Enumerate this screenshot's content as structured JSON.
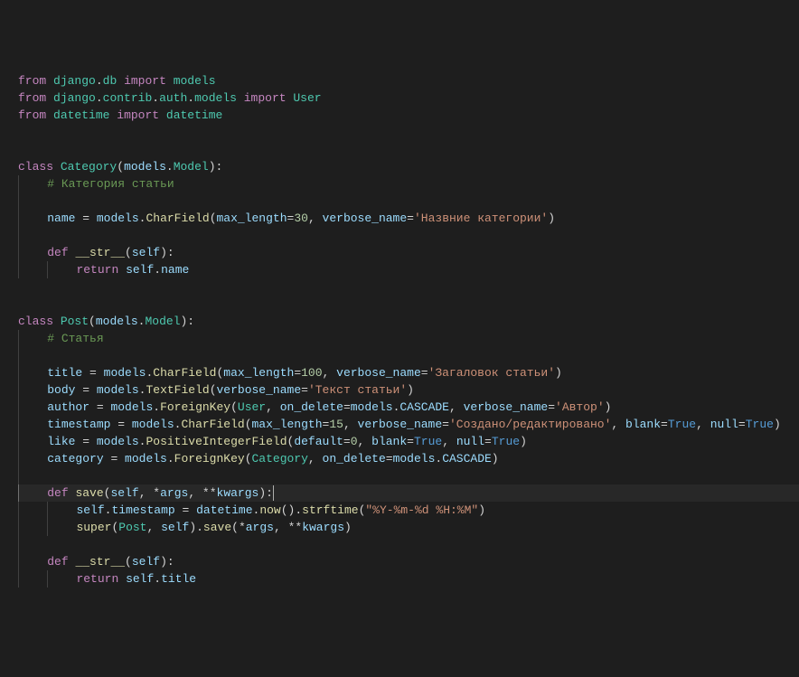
{
  "language": "python",
  "filename": "models.py",
  "cursor_line": 25,
  "lines": [
    {
      "indent": 0,
      "tokens": [
        {
          "c": "kw",
          "t": "from"
        },
        {
          "c": "punct",
          "t": " "
        },
        {
          "c": "mod",
          "t": "django"
        },
        {
          "c": "punct",
          "t": "."
        },
        {
          "c": "mod",
          "t": "db"
        },
        {
          "c": "punct",
          "t": " "
        },
        {
          "c": "kw",
          "t": "import"
        },
        {
          "c": "punct",
          "t": " "
        },
        {
          "c": "mod",
          "t": "models"
        }
      ]
    },
    {
      "indent": 0,
      "tokens": [
        {
          "c": "kw",
          "t": "from"
        },
        {
          "c": "punct",
          "t": " "
        },
        {
          "c": "mod",
          "t": "django"
        },
        {
          "c": "punct",
          "t": "."
        },
        {
          "c": "mod",
          "t": "contrib"
        },
        {
          "c": "punct",
          "t": "."
        },
        {
          "c": "mod",
          "t": "auth"
        },
        {
          "c": "punct",
          "t": "."
        },
        {
          "c": "mod",
          "t": "models"
        },
        {
          "c": "punct",
          "t": " "
        },
        {
          "c": "kw",
          "t": "import"
        },
        {
          "c": "punct",
          "t": " "
        },
        {
          "c": "mod",
          "t": "User"
        }
      ]
    },
    {
      "indent": 0,
      "tokens": [
        {
          "c": "kw",
          "t": "from"
        },
        {
          "c": "punct",
          "t": " "
        },
        {
          "c": "mod",
          "t": "datetime"
        },
        {
          "c": "punct",
          "t": " "
        },
        {
          "c": "kw",
          "t": "import"
        },
        {
          "c": "punct",
          "t": " "
        },
        {
          "c": "mod",
          "t": "datetime"
        }
      ]
    },
    {
      "indent": 0,
      "tokens": []
    },
    {
      "indent": 0,
      "tokens": []
    },
    {
      "indent": 0,
      "tokens": [
        {
          "c": "kw",
          "t": "class"
        },
        {
          "c": "punct",
          "t": " "
        },
        {
          "c": "mod",
          "t": "Category"
        },
        {
          "c": "punct",
          "t": "("
        },
        {
          "c": "name",
          "t": "models"
        },
        {
          "c": "punct",
          "t": "."
        },
        {
          "c": "mod",
          "t": "Model"
        },
        {
          "c": "punct",
          "t": "):"
        }
      ]
    },
    {
      "indent": 1,
      "tokens": [
        {
          "c": "comment",
          "t": "# Категория статьи"
        }
      ]
    },
    {
      "indent": 1,
      "tokens": []
    },
    {
      "indent": 1,
      "tokens": [
        {
          "c": "name",
          "t": "name"
        },
        {
          "c": "punct",
          "t": " = "
        },
        {
          "c": "name",
          "t": "models"
        },
        {
          "c": "punct",
          "t": "."
        },
        {
          "c": "fn",
          "t": "CharField"
        },
        {
          "c": "punct",
          "t": "("
        },
        {
          "c": "param",
          "t": "max_length"
        },
        {
          "c": "punct",
          "t": "="
        },
        {
          "c": "num",
          "t": "30"
        },
        {
          "c": "punct",
          "t": ", "
        },
        {
          "c": "param",
          "t": "verbose_name"
        },
        {
          "c": "punct",
          "t": "="
        },
        {
          "c": "str",
          "t": "'Назвние категории'"
        },
        {
          "c": "punct",
          "t": ")"
        }
      ]
    },
    {
      "indent": 1,
      "tokens": []
    },
    {
      "indent": 1,
      "tokens": [
        {
          "c": "kw",
          "t": "def"
        },
        {
          "c": "punct",
          "t": " "
        },
        {
          "c": "fn",
          "t": "__str__"
        },
        {
          "c": "punct",
          "t": "("
        },
        {
          "c": "param",
          "t": "self"
        },
        {
          "c": "punct",
          "t": "):"
        }
      ]
    },
    {
      "indent": 2,
      "tokens": [
        {
          "c": "kw",
          "t": "return"
        },
        {
          "c": "punct",
          "t": " "
        },
        {
          "c": "name",
          "t": "self"
        },
        {
          "c": "punct",
          "t": "."
        },
        {
          "c": "name",
          "t": "name"
        }
      ]
    },
    {
      "indent": 0,
      "tokens": []
    },
    {
      "indent": 0,
      "tokens": []
    },
    {
      "indent": 0,
      "tokens": [
        {
          "c": "kw",
          "t": "class"
        },
        {
          "c": "punct",
          "t": " "
        },
        {
          "c": "mod",
          "t": "Post"
        },
        {
          "c": "punct",
          "t": "("
        },
        {
          "c": "name",
          "t": "models"
        },
        {
          "c": "punct",
          "t": "."
        },
        {
          "c": "mod",
          "t": "Model"
        },
        {
          "c": "punct",
          "t": "):"
        }
      ]
    },
    {
      "indent": 1,
      "tokens": [
        {
          "c": "comment",
          "t": "# Статья"
        }
      ]
    },
    {
      "indent": 1,
      "tokens": []
    },
    {
      "indent": 1,
      "tokens": [
        {
          "c": "name",
          "t": "title"
        },
        {
          "c": "punct",
          "t": " = "
        },
        {
          "c": "name",
          "t": "models"
        },
        {
          "c": "punct",
          "t": "."
        },
        {
          "c": "fn",
          "t": "CharField"
        },
        {
          "c": "punct",
          "t": "("
        },
        {
          "c": "param",
          "t": "max_length"
        },
        {
          "c": "punct",
          "t": "="
        },
        {
          "c": "num",
          "t": "100"
        },
        {
          "c": "punct",
          "t": ", "
        },
        {
          "c": "param",
          "t": "verbose_name"
        },
        {
          "c": "punct",
          "t": "="
        },
        {
          "c": "str",
          "t": "'Загаловок статьи'"
        },
        {
          "c": "punct",
          "t": ")"
        }
      ]
    },
    {
      "indent": 1,
      "tokens": [
        {
          "c": "name",
          "t": "body"
        },
        {
          "c": "punct",
          "t": " = "
        },
        {
          "c": "name",
          "t": "models"
        },
        {
          "c": "punct",
          "t": "."
        },
        {
          "c": "fn",
          "t": "TextField"
        },
        {
          "c": "punct",
          "t": "("
        },
        {
          "c": "param",
          "t": "verbose_name"
        },
        {
          "c": "punct",
          "t": "="
        },
        {
          "c": "str",
          "t": "'Текст статьи'"
        },
        {
          "c": "punct",
          "t": ")"
        }
      ]
    },
    {
      "indent": 1,
      "tokens": [
        {
          "c": "name",
          "t": "author"
        },
        {
          "c": "punct",
          "t": " = "
        },
        {
          "c": "name",
          "t": "models"
        },
        {
          "c": "punct",
          "t": "."
        },
        {
          "c": "fn",
          "t": "ForeignKey"
        },
        {
          "c": "punct",
          "t": "("
        },
        {
          "c": "mod",
          "t": "User"
        },
        {
          "c": "punct",
          "t": ", "
        },
        {
          "c": "param",
          "t": "on_delete"
        },
        {
          "c": "punct",
          "t": "="
        },
        {
          "c": "name",
          "t": "models"
        },
        {
          "c": "punct",
          "t": "."
        },
        {
          "c": "name",
          "t": "CASCADE"
        },
        {
          "c": "punct",
          "t": ", "
        },
        {
          "c": "param",
          "t": "verbose_name"
        },
        {
          "c": "punct",
          "t": "="
        },
        {
          "c": "str",
          "t": "'Автор'"
        },
        {
          "c": "punct",
          "t": ")"
        }
      ]
    },
    {
      "indent": 1,
      "tokens": [
        {
          "c": "name",
          "t": "timestamp"
        },
        {
          "c": "punct",
          "t": " = "
        },
        {
          "c": "name",
          "t": "models"
        },
        {
          "c": "punct",
          "t": "."
        },
        {
          "c": "fn",
          "t": "CharField"
        },
        {
          "c": "punct",
          "t": "("
        },
        {
          "c": "param",
          "t": "max_length"
        },
        {
          "c": "punct",
          "t": "="
        },
        {
          "c": "num",
          "t": "15"
        },
        {
          "c": "punct",
          "t": ", "
        },
        {
          "c": "param",
          "t": "verbose_name"
        },
        {
          "c": "punct",
          "t": "="
        },
        {
          "c": "str",
          "t": "'Создано/редактировано'"
        },
        {
          "c": "punct",
          "t": ", "
        },
        {
          "c": "param",
          "t": "blank"
        },
        {
          "c": "punct",
          "t": "="
        },
        {
          "c": "const",
          "t": "True"
        },
        {
          "c": "punct",
          "t": ", "
        },
        {
          "c": "param",
          "t": "null"
        },
        {
          "c": "punct",
          "t": "="
        },
        {
          "c": "const",
          "t": "True"
        },
        {
          "c": "punct",
          "t": ")"
        }
      ]
    },
    {
      "indent": 1,
      "tokens": [
        {
          "c": "name",
          "t": "like"
        },
        {
          "c": "punct",
          "t": " = "
        },
        {
          "c": "name",
          "t": "models"
        },
        {
          "c": "punct",
          "t": "."
        },
        {
          "c": "fn",
          "t": "PositiveIntegerField"
        },
        {
          "c": "punct",
          "t": "("
        },
        {
          "c": "param",
          "t": "default"
        },
        {
          "c": "punct",
          "t": "="
        },
        {
          "c": "num",
          "t": "0"
        },
        {
          "c": "punct",
          "t": ", "
        },
        {
          "c": "param",
          "t": "blank"
        },
        {
          "c": "punct",
          "t": "="
        },
        {
          "c": "const",
          "t": "True"
        },
        {
          "c": "punct",
          "t": ", "
        },
        {
          "c": "param",
          "t": "null"
        },
        {
          "c": "punct",
          "t": "="
        },
        {
          "c": "const",
          "t": "True"
        },
        {
          "c": "punct",
          "t": ")"
        }
      ]
    },
    {
      "indent": 1,
      "tokens": [
        {
          "c": "name",
          "t": "category"
        },
        {
          "c": "punct",
          "t": " = "
        },
        {
          "c": "name",
          "t": "models"
        },
        {
          "c": "punct",
          "t": "."
        },
        {
          "c": "fn",
          "t": "ForeignKey"
        },
        {
          "c": "punct",
          "t": "("
        },
        {
          "c": "mod",
          "t": "Category"
        },
        {
          "c": "punct",
          "t": ", "
        },
        {
          "c": "param",
          "t": "on_delete"
        },
        {
          "c": "punct",
          "t": "="
        },
        {
          "c": "name",
          "t": "models"
        },
        {
          "c": "punct",
          "t": "."
        },
        {
          "c": "name",
          "t": "CASCADE"
        },
        {
          "c": "punct",
          "t": ")"
        }
      ]
    },
    {
      "indent": 1,
      "tokens": []
    },
    {
      "indent": 1,
      "active": true,
      "cursor": true,
      "tokens": [
        {
          "c": "kw",
          "t": "def"
        },
        {
          "c": "punct",
          "t": " "
        },
        {
          "c": "fn",
          "t": "save"
        },
        {
          "c": "punct",
          "t": "("
        },
        {
          "c": "param",
          "t": "self"
        },
        {
          "c": "punct",
          "t": ", *"
        },
        {
          "c": "param",
          "t": "args"
        },
        {
          "c": "punct",
          "t": ", **"
        },
        {
          "c": "param",
          "t": "kwargs"
        },
        {
          "c": "punct",
          "t": "):"
        }
      ]
    },
    {
      "indent": 2,
      "tokens": [
        {
          "c": "name",
          "t": "self"
        },
        {
          "c": "punct",
          "t": "."
        },
        {
          "c": "name",
          "t": "timestamp"
        },
        {
          "c": "punct",
          "t": " = "
        },
        {
          "c": "name",
          "t": "datetime"
        },
        {
          "c": "punct",
          "t": "."
        },
        {
          "c": "fn",
          "t": "now"
        },
        {
          "c": "punct",
          "t": "()."
        },
        {
          "c": "fn",
          "t": "strftime"
        },
        {
          "c": "punct",
          "t": "("
        },
        {
          "c": "str",
          "t": "\"%Y-%m-%d %H:%M\""
        },
        {
          "c": "punct",
          "t": ")"
        }
      ]
    },
    {
      "indent": 2,
      "tokens": [
        {
          "c": "fn",
          "t": "super"
        },
        {
          "c": "punct",
          "t": "("
        },
        {
          "c": "mod",
          "t": "Post"
        },
        {
          "c": "punct",
          "t": ", "
        },
        {
          "c": "name",
          "t": "self"
        },
        {
          "c": "punct",
          "t": ")."
        },
        {
          "c": "fn",
          "t": "save"
        },
        {
          "c": "punct",
          "t": "(*"
        },
        {
          "c": "name",
          "t": "args"
        },
        {
          "c": "punct",
          "t": ", **"
        },
        {
          "c": "name",
          "t": "kwargs"
        },
        {
          "c": "punct",
          "t": ")"
        }
      ]
    },
    {
      "indent": 1,
      "tokens": []
    },
    {
      "indent": 1,
      "tokens": [
        {
          "c": "kw",
          "t": "def"
        },
        {
          "c": "punct",
          "t": " "
        },
        {
          "c": "fn",
          "t": "__str__"
        },
        {
          "c": "punct",
          "t": "("
        },
        {
          "c": "param",
          "t": "self"
        },
        {
          "c": "punct",
          "t": "):"
        }
      ]
    },
    {
      "indent": 2,
      "tokens": [
        {
          "c": "kw",
          "t": "return"
        },
        {
          "c": "punct",
          "t": " "
        },
        {
          "c": "name",
          "t": "self"
        },
        {
          "c": "punct",
          "t": "."
        },
        {
          "c": "name",
          "t": "title"
        }
      ]
    }
  ],
  "colors": {
    "background": "#1e1e1e",
    "keyword": "#c586c0",
    "type": "#4ec9b0",
    "variable": "#9cdcfe",
    "function": "#dcdcaa",
    "string": "#ce9178",
    "number": "#b5cea8",
    "comment": "#6a9955",
    "constant": "#569cd6",
    "default": "#d4d4d4",
    "active_line": "#282828",
    "indent_guide": "#404040",
    "indent_guide_active": "#707070"
  }
}
